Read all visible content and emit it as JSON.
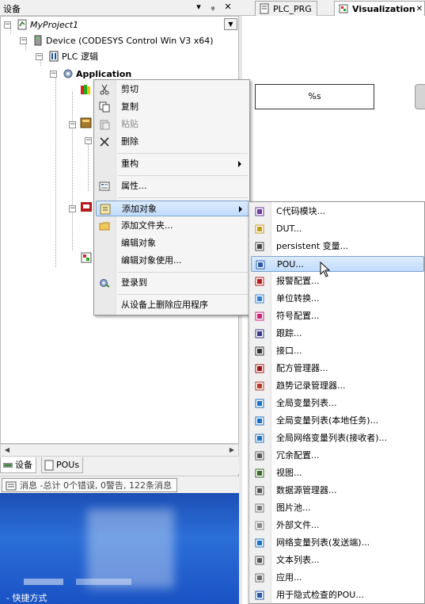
{
  "panel": {
    "title": "设备",
    "pin_label": "ᵩ",
    "close_label": "✕",
    "dropdown_label": "▾"
  },
  "tree": {
    "project": "MyProject1",
    "device": "Device (CODESYS Control Win V3 x64)",
    "plc_logic": "PLC 逻辑",
    "application": "Application"
  },
  "panel_tabs": {
    "devices": "设备",
    "pous": "POUs"
  },
  "messages": "消息 -总计 0个错误, 0警告, 122条消息",
  "desktop": {
    "shortcut_label": "- 快捷方式"
  },
  "editor": {
    "tabs": [
      {
        "label": "PLC_PRG"
      },
      {
        "label": "Visualization"
      }
    ],
    "close_label": "✕",
    "percent_text": "%s"
  },
  "context_menu": {
    "items": [
      {
        "label": "剪切",
        "icon": "scissors-icon"
      },
      {
        "label": "复制",
        "icon": "copy-icon"
      },
      {
        "label": "粘贴",
        "icon": "paste-icon",
        "disabled": true
      },
      {
        "label": "删除",
        "icon": "delete-x-icon"
      },
      {
        "label": "重构",
        "submenu": true
      },
      {
        "label": "属性...",
        "icon": "properties-icon"
      },
      {
        "label": "添加对象",
        "icon": "add-object-icon",
        "submenu": true,
        "highlighted": true
      },
      {
        "label": "添加文件夹...",
        "icon": "folder-icon"
      },
      {
        "label": "编辑对象"
      },
      {
        "label": "编辑对象使用..."
      },
      {
        "label": "登录到",
        "icon": "login-gear-icon"
      },
      {
        "label": "从设备上删除应用程序"
      }
    ]
  },
  "submenu": {
    "items": [
      {
        "label": "C代码模块...",
        "icon": "c-module-icon"
      },
      {
        "label": "DUT...",
        "icon": "dut-icon"
      },
      {
        "label": "persistent 变量...",
        "icon": "persistent-var-icon"
      },
      {
        "label": "POU...",
        "icon": "pou-icon",
        "highlighted": true
      },
      {
        "label": "报警配置...",
        "icon": "alarm-config-icon"
      },
      {
        "label": "单位转换...",
        "icon": "unit-conversion-icon"
      },
      {
        "label": "符号配置...",
        "icon": "symbol-config-icon"
      },
      {
        "label": "跟踪...",
        "icon": "trace-icon"
      },
      {
        "label": "接口...",
        "icon": "interface-icon"
      },
      {
        "label": "配方管理器...",
        "icon": "recipe-manager-icon"
      },
      {
        "label": "趋势记录管理器...",
        "icon": "trend-manager-icon"
      },
      {
        "label": "全局变量列表...",
        "icon": "gvl-icon"
      },
      {
        "label": "全局变量列表(本地任务)...",
        "icon": "gvl-local-task-icon"
      },
      {
        "label": "全局网络变量列表(接收者)...",
        "icon": "network-gvl-receiver-icon"
      },
      {
        "label": "冗余配置...",
        "icon": "redundancy-icon"
      },
      {
        "label": "视图...",
        "icon": "view-icon"
      },
      {
        "label": "数据源管理器...",
        "icon": "datasource-manager-icon"
      },
      {
        "label": "图片池...",
        "icon": "image-pool-icon"
      },
      {
        "label": "外部文件...",
        "icon": "external-file-icon"
      },
      {
        "label": "网络变量列表(发送端)...",
        "icon": "network-var-sender-icon"
      },
      {
        "label": "文本列表...",
        "icon": "text-list-icon"
      },
      {
        "label": "应用...",
        "icon": "application-icon"
      },
      {
        "label": "用于隐式检查的POU...",
        "icon": "implicit-check-pou-icon"
      }
    ]
  }
}
